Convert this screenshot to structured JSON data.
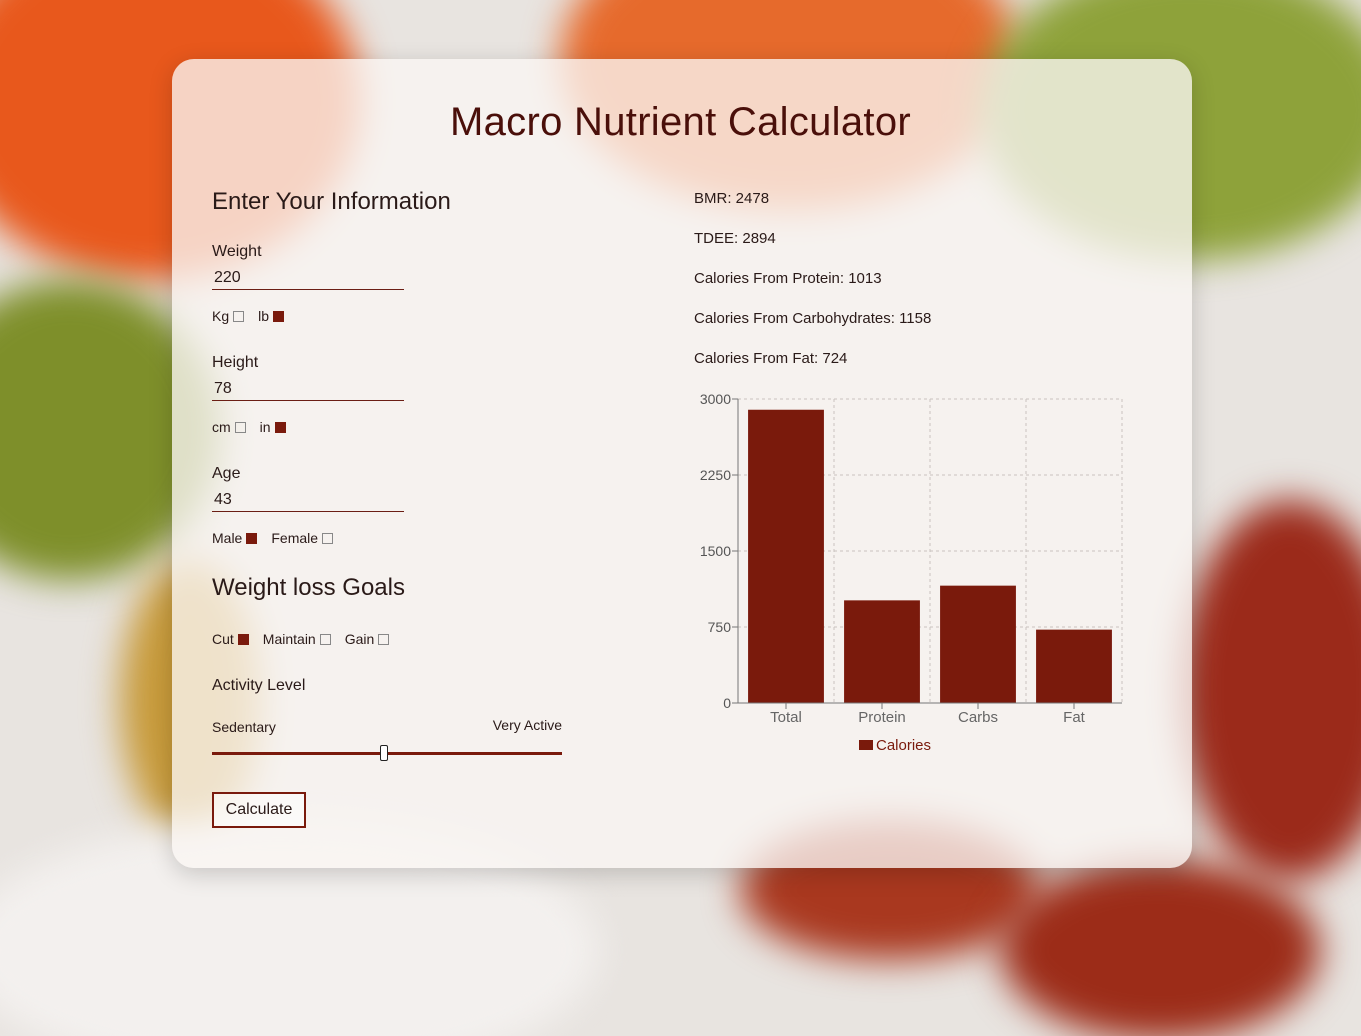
{
  "app": {
    "title": "Macro Nutrient Calculator"
  },
  "form": {
    "section_title": "Enter Your Information",
    "weight": {
      "label": "Weight",
      "value": "220",
      "units": [
        {
          "label": "Kg",
          "checked": false
        },
        {
          "label": "lb",
          "checked": true
        }
      ]
    },
    "height": {
      "label": "Height",
      "value": "78",
      "units": [
        {
          "label": "cm",
          "checked": false
        },
        {
          "label": "in",
          "checked": true
        }
      ]
    },
    "age": {
      "label": "Age",
      "value": "43",
      "sex": [
        {
          "label": "Male",
          "checked": true
        },
        {
          "label": "Female",
          "checked": false
        }
      ]
    },
    "goals_title": "Weight loss Goals",
    "goals": [
      {
        "label": "Cut",
        "checked": true
      },
      {
        "label": "Maintain",
        "checked": false
      },
      {
        "label": "Gain",
        "checked": false
      }
    ],
    "activity": {
      "title": "Activity Level",
      "min_label": "Sedentary",
      "max_label": "Very Active",
      "level_fraction": 0.49
    },
    "calculate_label": "Calculate"
  },
  "results": [
    {
      "key": "BMR:",
      "value": "2478"
    },
    {
      "key": "TDEE:",
      "value": "2894"
    },
    {
      "key": "Calories From Protein:",
      "value": "1013"
    },
    {
      "key": "Calories From Carbohydrates:",
      "value": "1158"
    },
    {
      "key": "Calories From Fat:",
      "value": "724"
    }
  ],
  "colors": {
    "accent": "#7a1a0c",
    "title": "#4a0f0a"
  },
  "chart_data": {
    "type": "bar",
    "categories": [
      "Total",
      "Protein",
      "Carbs",
      "Fat"
    ],
    "series": [
      {
        "name": "Calories",
        "values": [
          2894,
          1013,
          1158,
          724
        ]
      }
    ],
    "yticks": [
      "0",
      "750",
      "1500",
      "2250",
      "3000"
    ],
    "ylim": [
      0,
      3000
    ],
    "grid": true,
    "legend": "bottom",
    "color": "#7a1a0c"
  }
}
